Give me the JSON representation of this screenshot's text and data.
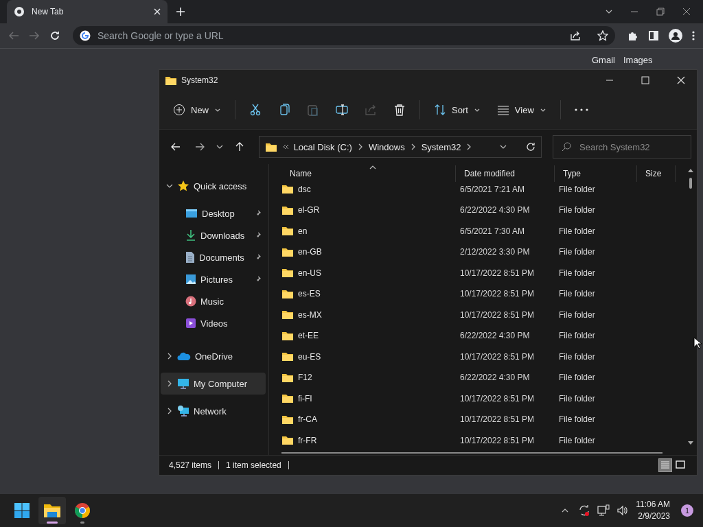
{
  "browser": {
    "tab": {
      "title": "New Tab",
      "selected": true
    },
    "nav": {
      "back_disabled": true,
      "forward_disabled": true
    },
    "omnibox": {
      "placeholder": "Search Google or type a URL"
    },
    "page_links": [
      "Gmail",
      "Images"
    ]
  },
  "explorer": {
    "title": "System32",
    "commands": [
      {
        "kind": "new",
        "label": "New",
        "disabled": false
      },
      {
        "kind": "cut",
        "disabled": false
      },
      {
        "kind": "copy",
        "disabled": false
      },
      {
        "kind": "paste",
        "disabled": true
      },
      {
        "kind": "rename",
        "disabled": false
      },
      {
        "kind": "share",
        "disabled": true
      },
      {
        "kind": "delete",
        "disabled": false
      },
      {
        "kind": "sort",
        "label": "Sort",
        "disabled": false
      },
      {
        "kind": "view",
        "label": "View",
        "disabled": false
      },
      {
        "kind": "more",
        "disabled": false
      }
    ],
    "breadcrumb": [
      "Local Disk (C:)",
      "Windows",
      "System32"
    ],
    "search": {
      "placeholder": "Search System32"
    },
    "nav_pane": [
      {
        "label": "Quick access",
        "kind": "star",
        "expanded": true,
        "selected": false,
        "children": [
          {
            "label": "Desktop",
            "kind": "desktop",
            "pinned": true
          },
          {
            "label": "Downloads",
            "kind": "download",
            "pinned": true
          },
          {
            "label": "Documents",
            "kind": "document",
            "pinned": true
          },
          {
            "label": "Pictures",
            "kind": "pictures",
            "pinned": true
          },
          {
            "label": "Music",
            "kind": "music",
            "pinned": false
          },
          {
            "label": "Videos",
            "kind": "videos",
            "pinned": false
          }
        ]
      },
      {
        "label": "OneDrive",
        "kind": "cloud",
        "expanded": false,
        "selected": false
      },
      {
        "label": "My Computer",
        "kind": "computer",
        "expanded": false,
        "selected": true
      },
      {
        "label": "Network",
        "kind": "network",
        "expanded": false,
        "selected": false
      }
    ],
    "columns": [
      "Name",
      "Date modified",
      "Type",
      "Size"
    ],
    "rows": [
      {
        "name": "dsc",
        "date": "6/5/2021 7:21 AM",
        "type": "File folder"
      },
      {
        "name": "el-GR",
        "date": "6/22/2022 4:30 PM",
        "type": "File folder"
      },
      {
        "name": "en",
        "date": "6/5/2021 7:30 AM",
        "type": "File folder"
      },
      {
        "name": "en-GB",
        "date": "2/12/2022 3:30 PM",
        "type": "File folder"
      },
      {
        "name": "en-US",
        "date": "10/17/2022 8:51 PM",
        "type": "File folder"
      },
      {
        "name": "es-ES",
        "date": "10/17/2022 8:51 PM",
        "type": "File folder"
      },
      {
        "name": "es-MX",
        "date": "10/17/2022 8:51 PM",
        "type": "File folder"
      },
      {
        "name": "et-EE",
        "date": "6/22/2022 4:30 PM",
        "type": "File folder"
      },
      {
        "name": "eu-ES",
        "date": "10/17/2022 8:51 PM",
        "type": "File folder"
      },
      {
        "name": "F12",
        "date": "6/22/2022 4:30 PM",
        "type": "File folder"
      },
      {
        "name": "fi-FI",
        "date": "10/17/2022 8:51 PM",
        "type": "File folder"
      },
      {
        "name": "fr-CA",
        "date": "10/17/2022 8:51 PM",
        "type": "File folder"
      },
      {
        "name": "fr-FR",
        "date": "10/17/2022 8:51 PM",
        "type": "File folder"
      }
    ],
    "status": {
      "count": "4,527 items",
      "selection": "1 item selected"
    },
    "views": [
      {
        "kind": "details",
        "selected": true
      },
      {
        "kind": "tiles",
        "selected": false
      }
    ]
  },
  "taskbar": {
    "apps": [
      {
        "kind": "start",
        "active": false,
        "running": false
      },
      {
        "kind": "explorer",
        "active": true,
        "running": true
      },
      {
        "kind": "chrome",
        "active": false,
        "running": true
      }
    ],
    "time": "11:06 AM",
    "date": "2/9/2023",
    "notifications": "1"
  }
}
